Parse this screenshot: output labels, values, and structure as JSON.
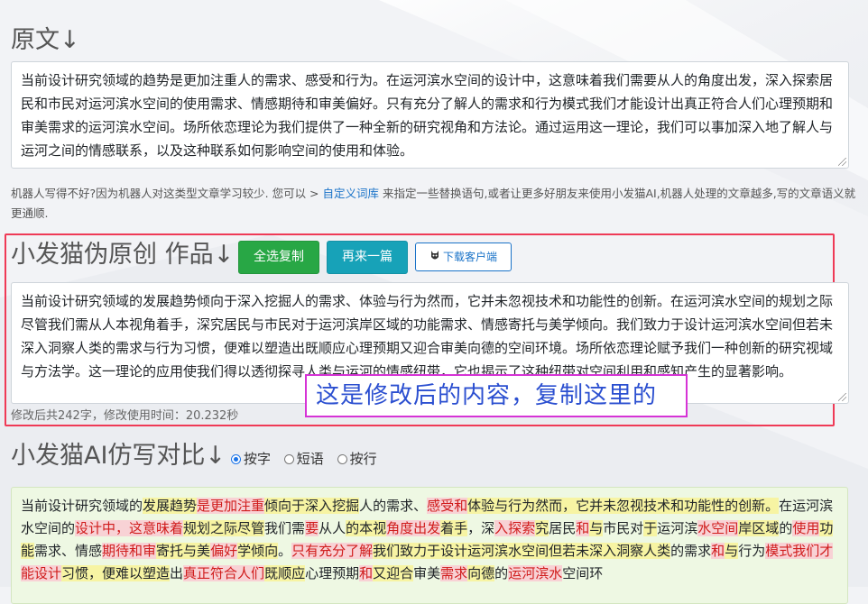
{
  "original": {
    "title": "原文↓",
    "text": "当前设计研究领域的趋势是更加注重人的需求、感受和行为。在运河滨水空间的设计中，这意味着我们需要从人的角度出发，深入探索居民和市民对运河滨水空间的使用需求、情感期待和审美偏好。只有充分了解人的需求和行为模式我们才能设计出真正符合人们心理预期和审美需求的运河滨水空间。场所依恋理论为我们提供了一种全新的研究视角和方法论。通过运用这一理论，我们可以事加深入地了解人与运河之间的情感联系，以及这种联系如何影响空间的使用和体验。"
  },
  "notice": {
    "before": "机器人写得不好?因为机器人对这类型文章学习较少. 您可以 > ",
    "link": "自定义词库",
    "after": " 来指定一些替换语句,或者让更多好朋友来使用小发猫AI,机器人处理的文章越多,写的文章语义就更通顺."
  },
  "rewrite": {
    "title": "小发猫伪原创 作品↓",
    "copy_all_label": "全选复制",
    "another_label": "再来一篇",
    "download_label": "下载客户端",
    "text": "当前设计研究领域的发展趋势倾向于深入挖掘人的需求、体验与行为然而，它并未忽视技术和功能性的创新。在运河滨水空间的规划之际尽管我们需从人本视角着手，深究居民与市民对于运河滨岸区域的功能需求、情感寄托与美学倾向。我们致力于设计运河滨水空间但若未深入洞察人类的需求与行为习惯，便难以塑造出既顺应心理预期又迎合审美向德的空间环境。场所依恋理论赋予我们一种创新的研究视域与方法学。这一理论的应用使我们得以透彻探寻人类与运河的情感纽带，它也揭示了这种纽带对空间利用和感知产生的显著影响。",
    "meta": "修改后共242字，修改使用时间：20.232秒",
    "overlay_note": "这是修改后的内容，复制这里的"
  },
  "compare": {
    "title": "小发猫AI仿写对比↓",
    "options": [
      "按字",
      "短语",
      "按行"
    ],
    "selected": "按字",
    "segments": [
      [
        "n",
        "当前设计研究领域的"
      ],
      [
        "y",
        "发展趋势"
      ],
      [
        "r",
        "是更加注重"
      ],
      [
        "y",
        "倾向于深入挖掘"
      ],
      [
        "n",
        "人的需求、"
      ],
      [
        "r",
        "感受和"
      ],
      [
        "y",
        "体验与行为然而，它并未忽视技术和功能性的创新。"
      ],
      [
        "n",
        "在运河滨水空间的"
      ],
      [
        "r",
        "设计中，这意味着"
      ],
      [
        "y",
        "规划之际尽管"
      ],
      [
        "n",
        "我们需"
      ],
      [
        "r",
        "要"
      ],
      [
        "n",
        "从人"
      ],
      [
        "y",
        "的本视"
      ],
      [
        "r",
        "角度出发"
      ],
      [
        "y",
        "着手"
      ],
      [
        "n",
        "，深"
      ],
      [
        "r",
        "入探索"
      ],
      [
        "y",
        "究"
      ],
      [
        "n",
        "居民"
      ],
      [
        "r",
        "和"
      ],
      [
        "y",
        "与"
      ],
      [
        "n",
        "市民对"
      ],
      [
        "y",
        "于"
      ],
      [
        "n",
        "运河滨"
      ],
      [
        "r",
        "水空间"
      ],
      [
        "y",
        "岸区域"
      ],
      [
        "n",
        "的"
      ],
      [
        "r",
        "使用"
      ],
      [
        "y",
        "功能"
      ],
      [
        "n",
        "需求、情感"
      ],
      [
        "r",
        "期待和审"
      ],
      [
        "y",
        "寄托与美"
      ],
      [
        "r",
        "偏好"
      ],
      [
        "y",
        "学倾向"
      ],
      [
        "n",
        "。"
      ],
      [
        "r",
        "只有充分了解"
      ],
      [
        "y",
        "我们致力于设计运河滨水空间但若未深入洞察人类"
      ],
      [
        "n",
        "的需求"
      ],
      [
        "r",
        "和"
      ],
      [
        "y",
        "与"
      ],
      [
        "n",
        "行为"
      ],
      [
        "r",
        "模式我们才能设计"
      ],
      [
        "y",
        "习惯，便难以塑造"
      ],
      [
        "n",
        "出"
      ],
      [
        "r",
        "真正符合人们"
      ],
      [
        "y",
        "既顺应"
      ],
      [
        "n",
        "心理预期"
      ],
      [
        "r",
        "和"
      ],
      [
        "y",
        "又迎合"
      ],
      [
        "n",
        "审美"
      ],
      [
        "r",
        "需求"
      ],
      [
        "y",
        "向德"
      ],
      [
        "n",
        "的"
      ],
      [
        "r",
        "运河滨水"
      ],
      [
        "n",
        "空间环"
      ]
    ]
  },
  "colors": {
    "accent_link": "#1a73c8",
    "frame_red": "#ef3a56",
    "frame_magenta": "#d633d6",
    "note_blue": "#2b4fd0",
    "btn_green": "#28a745",
    "btn_teal": "#17a2b8",
    "diff_yellow": "#f7f4a3",
    "diff_red": "#f8d2d5"
  },
  "icons": {
    "download": "cat-logo-icon"
  }
}
